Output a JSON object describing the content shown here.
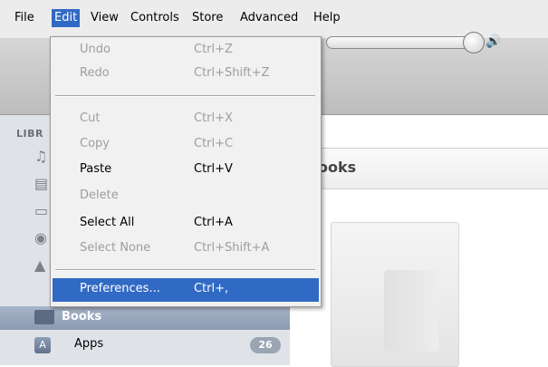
{
  "menubar": {
    "items": [
      "File",
      "Edit",
      "View",
      "Controls",
      "Store",
      "Advanced",
      "Help"
    ],
    "active": "Edit"
  },
  "toolbar": {
    "volume_level": 0.92
  },
  "sidebar": {
    "library_header": "LIBR",
    "books_label": "Books",
    "apps_label": "Apps",
    "apps_badge": "26"
  },
  "main": {
    "header_title": "ooks"
  },
  "edit_menu": {
    "items": [
      {
        "label": "Undo",
        "shortcut": "Ctrl+Z",
        "enabled": false
      },
      {
        "label": "Redo",
        "shortcut": "Ctrl+Shift+Z",
        "enabled": false
      },
      {
        "label": "Cut",
        "shortcut": "Ctrl+X",
        "enabled": false
      },
      {
        "label": "Copy",
        "shortcut": "Ctrl+C",
        "enabled": false
      },
      {
        "label": "Paste",
        "shortcut": "Ctrl+V",
        "enabled": true
      },
      {
        "label": "Delete",
        "shortcut": "",
        "enabled": false
      },
      {
        "label": "Select All",
        "shortcut": "Ctrl+A",
        "enabled": true
      },
      {
        "label": "Select None",
        "shortcut": "Ctrl+Shift+A",
        "enabled": false
      },
      {
        "label": "Preferences...",
        "shortcut": "Ctrl+,",
        "enabled": true,
        "highlighted": true
      }
    ]
  },
  "colors": {
    "menu_highlight": "#316ac5",
    "sidebar_bg": "#dfe3e8",
    "sidebar_selected": "#8c9bb3"
  }
}
